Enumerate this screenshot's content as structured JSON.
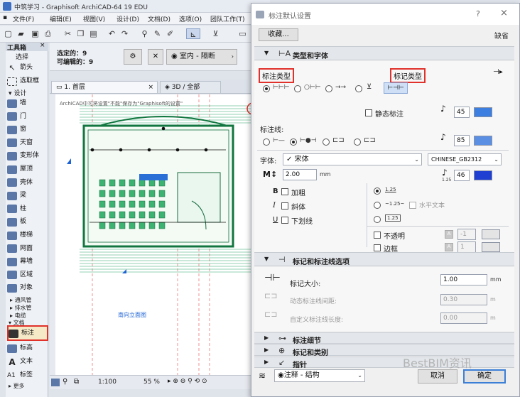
{
  "app": {
    "title": "中筑学习 - Graphisoft ArchiCAD-64 19 EDU",
    "menu": [
      "文件(F)",
      "编辑(E)",
      "视图(V)",
      "设计(D)",
      "文档(D)",
      "选项(O)",
      "团队工作(T)",
      "绘"
    ],
    "infobox": {
      "selected_label": "选定的：9",
      "editable_label": "可编辑的：9",
      "view_option": "室内 - 隔断"
    },
    "toolbox": {
      "title": "工具箱",
      "select_label": "选择",
      "arrow_label": "箭头",
      "marquee_label": "选取框",
      "design_label": "设计",
      "design_tools": [
        "墙",
        "门",
        "窗",
        "天窗",
        "变形体",
        "屋顶",
        "壳体",
        "梁",
        "柱",
        "板",
        "楼梯",
        "网面",
        "幕墙",
        "区域",
        "对象"
      ],
      "tree_items": [
        "通风管",
        "排水管",
        "电缆"
      ],
      "document_label": "文档",
      "dim_label": "标注",
      "level_label": "标高",
      "text_label": "文本",
      "label_label": "标签",
      "more_label": "更多"
    },
    "tabs": {
      "floor": "1. 首层",
      "view3d": "3D / 全部"
    },
    "canvas_text": {
      "top_note": "ArchiCAD中可将设置\"不能\"保存为\"Graphisoft的设置\"",
      "plan_label": "南向立面图"
    },
    "status": {
      "scale": "1:100",
      "zoom": "55 %"
    }
  },
  "dialog": {
    "title": "标注默认设置",
    "help": "?",
    "favorites": "收藏...",
    "defaults": "缺省",
    "section1": {
      "title": "类型和字体"
    },
    "dim_type_label": "标注类型",
    "marker_type_label": "标记类型",
    "static_dim_label": "静态标注",
    "pen1": "45",
    "dim_line_label": "标注线:",
    "pen2": "85",
    "font_label": "字体:",
    "font_value": "宋体",
    "font_check": "✓",
    "charset": "CHINESE_GB2312",
    "size_value": "2.00",
    "size_unit": "mm",
    "pen3": "46",
    "pen3_sub": "1.25",
    "bold": "加粗",
    "italic": "斜体",
    "underline": "下划线",
    "radio_a": "1.25",
    "radio_b": "~1.25~",
    "radio_c": "1.25",
    "horizontal_text": "水平文本",
    "opaque": "不透明",
    "frame": "边框",
    "opaque_value": "-1",
    "frame_value": "1",
    "section2": {
      "title": "标记和标注线选项"
    },
    "marker_size_label": "标记大小:",
    "marker_size_value": "1.00",
    "marker_size_unit": "mm",
    "dyn_gap_label": "动态标注线间距:",
    "dyn_gap_value": "0.30",
    "dyn_gap_unit": "m",
    "custom_len_label": "自定义标注线长度:",
    "custom_len_value": "0.00",
    "custom_len_unit": "m",
    "section3": {
      "title": "标注细节"
    },
    "section4": {
      "title": "标记和类别"
    },
    "section5": {
      "title": "指针"
    },
    "layer_value": "注释 - 结构",
    "cancel": "取消",
    "ok": "确定"
  },
  "watermark": "BestBIM资讯",
  "colors": {
    "highlight": "#e0312b",
    "accent_blue": "#1e63d6"
  }
}
